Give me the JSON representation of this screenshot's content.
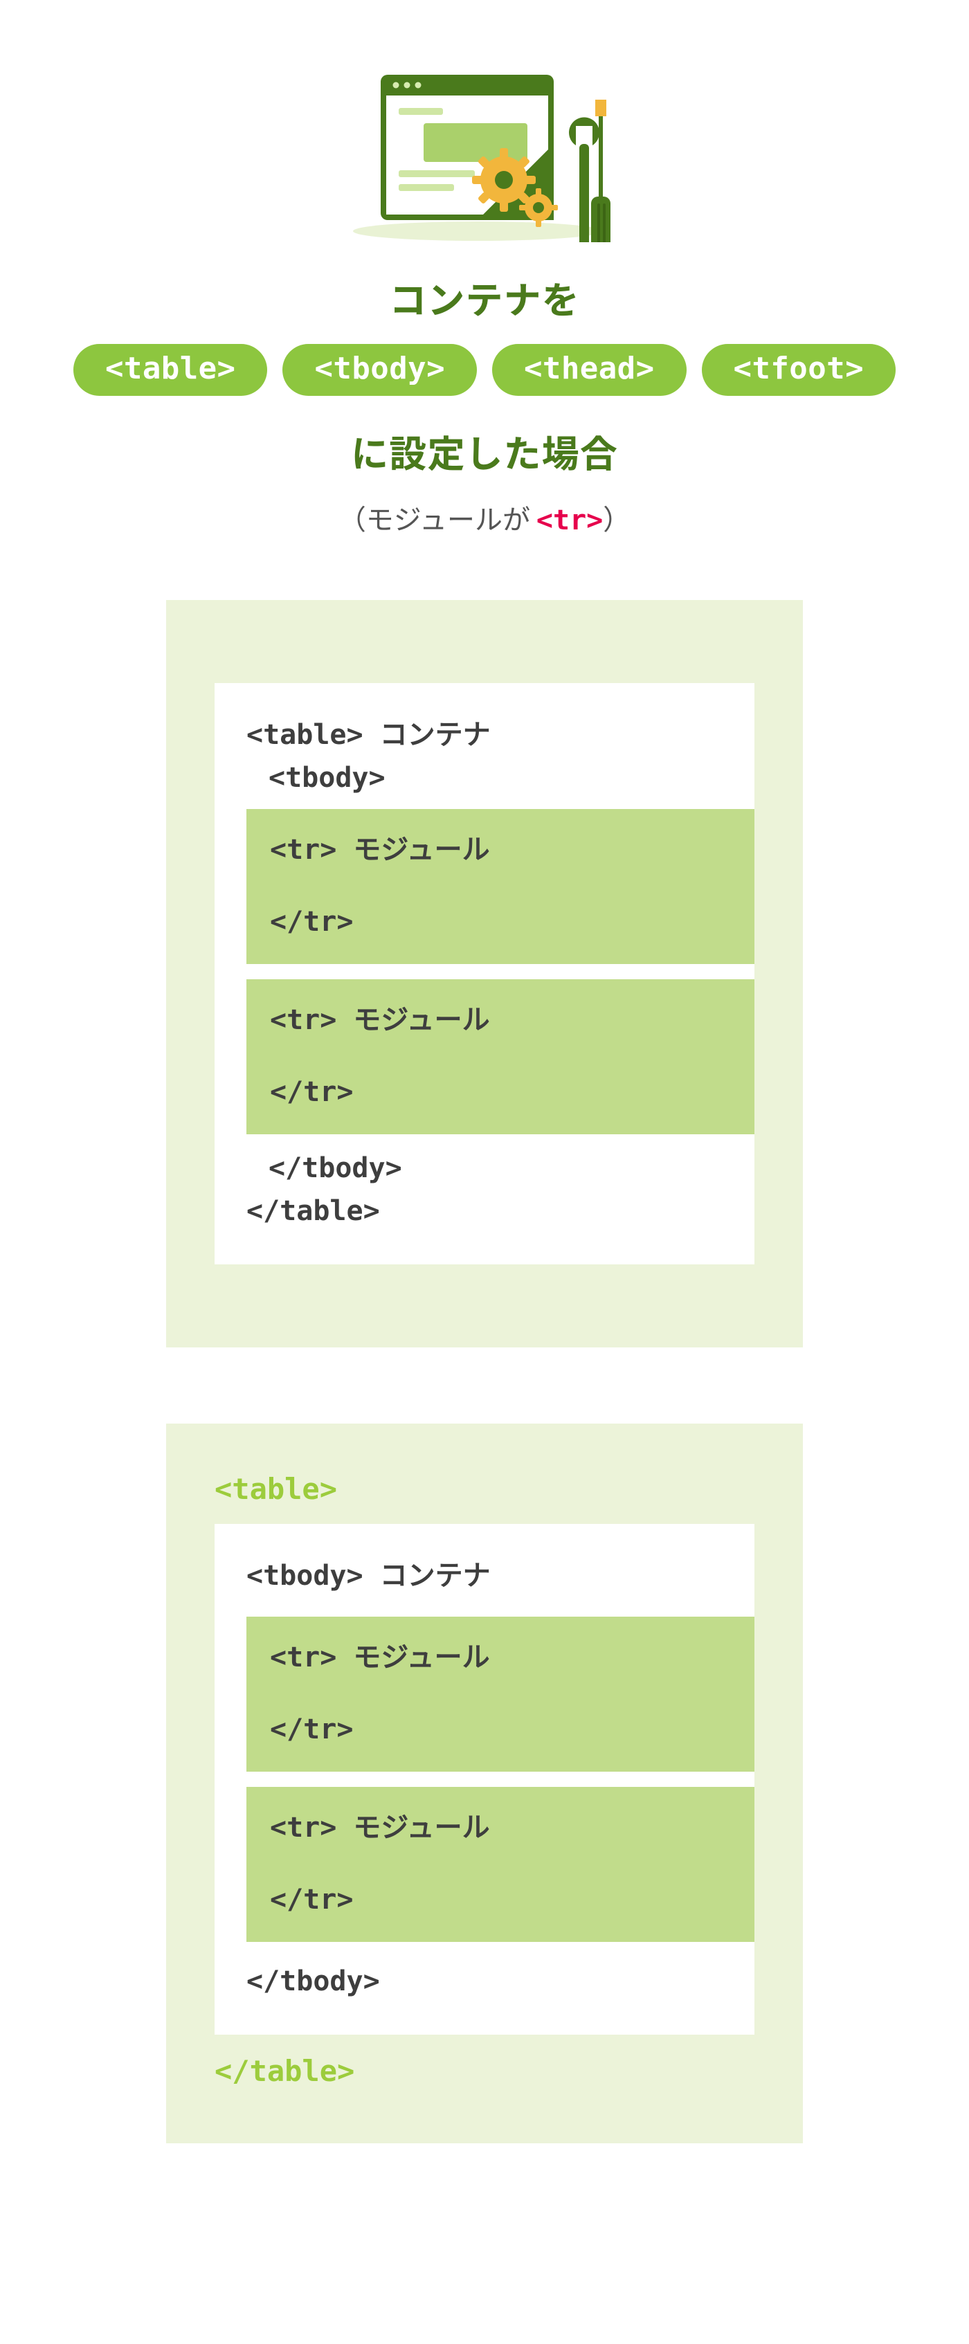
{
  "heading": {
    "line1": "コンテナを",
    "line2": "に設定した場合"
  },
  "pills": [
    "<table>",
    "<tbody>",
    "<thead>",
    "<tfoot>"
  ],
  "subtitle": {
    "prefix": "（モジュールが ",
    "tag": "<tr>",
    "suffix": "）"
  },
  "diagrams": [
    {
      "id": "table-as-container",
      "outerOpen": "",
      "outerClose": "",
      "containerOpen": "<table> コンテナ",
      "containerOpen2": "<tbody>",
      "modules": [
        {
          "open": "<tr> モジュール",
          "close": "</tr>"
        },
        {
          "open": "<tr> モジュール",
          "close": "</tr>"
        }
      ],
      "containerClose2": "</tbody>",
      "containerClose": "</table>"
    },
    {
      "id": "tbody-as-container",
      "outerOpen": "<table>",
      "outerClose": "</table>",
      "containerOpen": "<tbody> コンテナ",
      "containerOpen2": "",
      "modules": [
        {
          "open": "<tr> モジュール",
          "close": "</tr>"
        },
        {
          "open": "<tr> モジュール",
          "close": "</tr>"
        }
      ],
      "containerClose2": "",
      "containerClose": "</tbody>"
    }
  ]
}
